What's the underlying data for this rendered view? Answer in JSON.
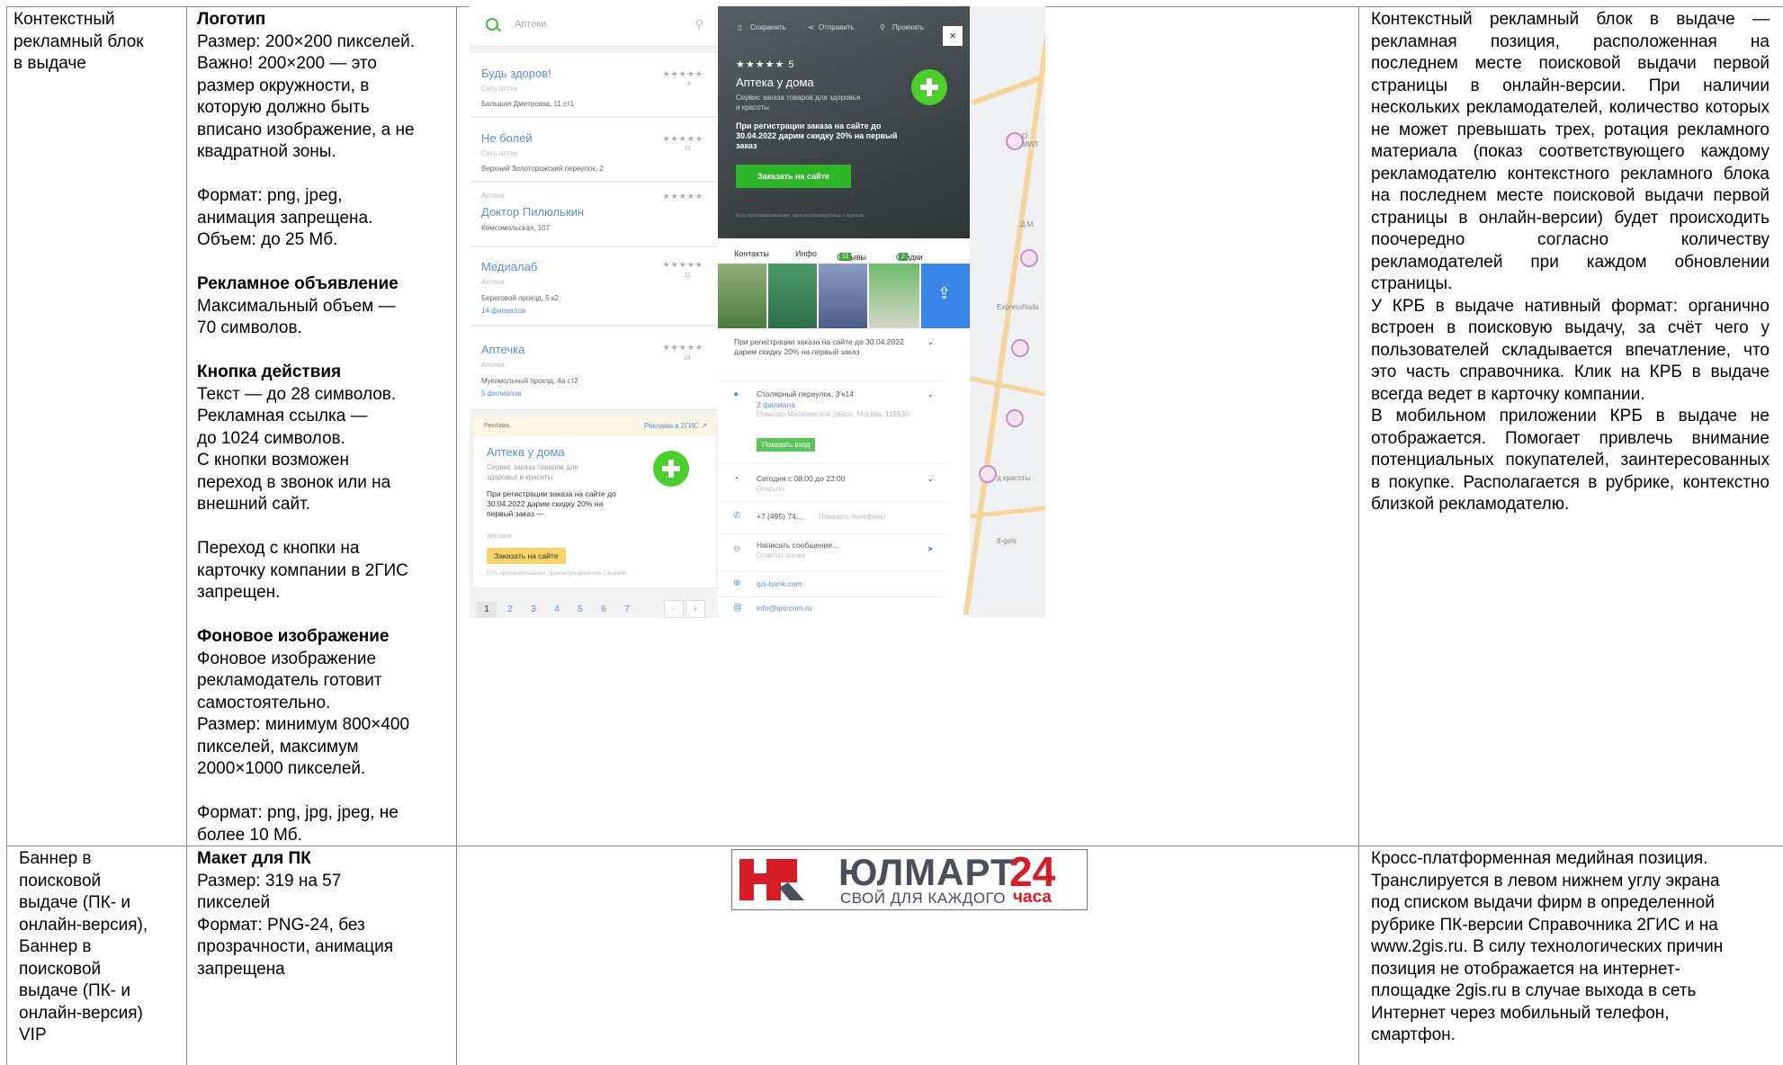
{
  "table": {
    "row1": {
      "title": "Контекстный\nрекламный блок\nв выдаче",
      "specs": [
        {
          "heading": "Логотип",
          "lines": [
            "Размер: 200×200 пикселей.",
            "Важно! 200×200 — это",
            "размер окружности, в",
            "которую должно быть",
            "вписано изображение, а не",
            "квадратной зоны."
          ]
        },
        {
          "heading": "",
          "lines": [
            "Формат: png, jpeg,",
            "анимация запрещена.",
            "Объем: до 25 Мб."
          ]
        },
        {
          "heading": "Рекламное объявление",
          "lines": [
            "Максимальный объем —",
            "70 символов."
          ]
        },
        {
          "heading": "Кнопка действия",
          "lines": [
            "Текст — до 28 символов.",
            "Рекламная ссылка —",
            "до 1024 символов.",
            "С кнопки возможен",
            "переход в звонок или на",
            "внешний сайт."
          ]
        },
        {
          "heading": "",
          "lines": [
            "Переход с кнопки на",
            "карточку компании в 2ГИС",
            "запрещен."
          ]
        },
        {
          "heading": "Фоновое изображение",
          "lines": [
            "Фоновое изображение",
            "рекламодатель готовит",
            "самостоятельно.",
            "Размер: минимум 800×400",
            "пикселей, максимум",
            "2000×1000 пикселей."
          ]
        },
        {
          "heading": "",
          "lines": [
            "Формат: png, jpg, jpeg, не",
            "более 10 Мб."
          ]
        }
      ],
      "description": [
        "Контекстный рекламный блок в выдаче — рекламная позиция, расположенная на последнем месте поисковой выдачи первой страницы в онлайн-версии. При наличии нескольких рекламодателей, количество которых не может превышать трех, ротация рекламного материала (показ соответствующего каждому рекламодателю контекстного рекламного блока на последнем месте поисковой выдачи первой страницы в онлайн-версии) будет происходить поочередно согласно количеству рекламодателей при каждом обновлении страницы.",
        "У КРБ в выдаче нативный формат: органично встроен в поисковую выдачу, за счёт чего у пользователей складывается впечатление, что это часть справочника. Клик на КРБ в выдаче всегда ведет в карточку компании.",
        "В мобильном приложении КРБ в выдаче не отображается. Помогает привлечь внимание потенциальных покупателей, заинтересованных в покупке. Располагается в рубрике, контекстно близкой рекламодателю."
      ]
    },
    "row2": {
      "title": "Баннер в\nпоисковой\nвыдаче (ПК- и\nонлайн-версия),\nБаннер в\nпоисковой\nвыдаче (ПК- и\nонлайн-версия)\nVIP",
      "spec_heading": "Макет для ПК",
      "spec_lines": [
        "Размер: 319 на 57",
        "пикселей",
        "Формат: PNG-24, без",
        "прозрачности, анимация",
        "запрещена"
      ],
      "description": "Кросс-платформенная медийная позиция.\nТранслируется в левом нижнем углу экрана\nпод списком выдачи фирм в определенной\nрубрике ПК-версии Справочника 2ГИС и на\nwww.2gis.ru. В силу технологических причин\nпозиция не отображается на интернет-\nплощадке 2gis.ru в случае выхода в сеть\nИнтернет через мобильный телефон,\nсмартфон."
    }
  },
  "screenshot": {
    "search_placeholder": "Аптеки",
    "list": [
      {
        "name": "Будь здоров!",
        "category": "Сеть аптек",
        "address": "Большая Дмитровка, 11 ст1",
        "reviews": "4",
        "branches": ""
      },
      {
        "name": "Не болей",
        "category": "Сеть аптек",
        "address": "Верхний Золоторожский переулок, 2",
        "reviews": "11",
        "branches": ""
      },
      {
        "name": "Доктор Пилюлькин",
        "category": "Аптека",
        "address": "Комсомольская, 107",
        "reviews": "",
        "branches": ""
      },
      {
        "name": "Медиалаб",
        "category": "Аптека",
        "address": "Береговой проезд, 5 к2",
        "reviews": "11",
        "branches": "14 филиалов"
      },
      {
        "name": "Аптечка",
        "category": "Аптека",
        "address": "Мукомольный проезд, 4а ст2",
        "reviews": "24",
        "branches": "5 филиалов"
      }
    ],
    "stars": "★★★★★",
    "promo": {
      "label": "Реклама",
      "link": "Реклама в 2ГИС ↗",
      "name": "Аптека у дома",
      "desc": "Сервис заказа товаров для здоровья и красоты",
      "text": "При регистрации заказа на сайте до 30.04.2022 дарим скидку 20% на первый заказ —",
      "tag": "реклама",
      "button": "Заказать на сайте",
      "warning": "Есть противопоказания, проконсультируйтесь с врачом."
    },
    "pages": [
      "1",
      "2",
      "3",
      "4",
      "5",
      "6",
      "7"
    ],
    "card": {
      "toolbar": [
        "Сохранить",
        "Отправить",
        "Проехать"
      ],
      "close": "×",
      "stars": "★★★★★ 5",
      "name": "Аптека у дома",
      "desc": "Сервис заказа товаров для здоровья и красоты",
      "text": "При регистрации заказа на сайте до 30.04.2022 дарим скидку 20% на первый заказ",
      "button": "Заказать на сайте",
      "warning": "Есть противопоказания, проконсультируйтесь с врачом.",
      "tabs": {
        "contacts": "Контакты",
        "info": "Инфо",
        "reviews": "Отзывы",
        "reviews_count": "11",
        "discounts": "Скидки",
        "discounts_count": "2"
      },
      "promo_text": "При регистрации заказа на сайте до 30.04.2022 дарим скидку 20% на первый заказ",
      "address": "Столярный переулок, 3 к14",
      "branches": "2 филиала",
      "district": "Очаково-Матвеевское район, Москва, 119530",
      "show_entrance": "Показать вход",
      "hours": "Сегодня с 08:00 до 22:00",
      "hours_status": "Открыто",
      "phone": "+7 (495) 74...",
      "show_phone": "Показать телефоны",
      "message": "Написать сообщение...",
      "message_sub": "Ответит позже",
      "site": "ips-bank.com",
      "email": "info@ips.com.ru"
    },
    "map_labels": [
      "О МИЛ",
      "ExpressNails",
      "д красоты",
      "8-girls",
      "Д.М."
    ]
  },
  "banner": {
    "brand": "ЮЛМАРТ",
    "number": "24",
    "slogan": "СВОЙ ДЛЯ КАЖДОГО",
    "hours": "часа"
  },
  "colors": {
    "border": "#8a8a8a",
    "link_blue": "#5b8ed6",
    "green": "#2fb52a",
    "brand_red": "#d41d24",
    "brand_dark": "#4a4f5c"
  }
}
